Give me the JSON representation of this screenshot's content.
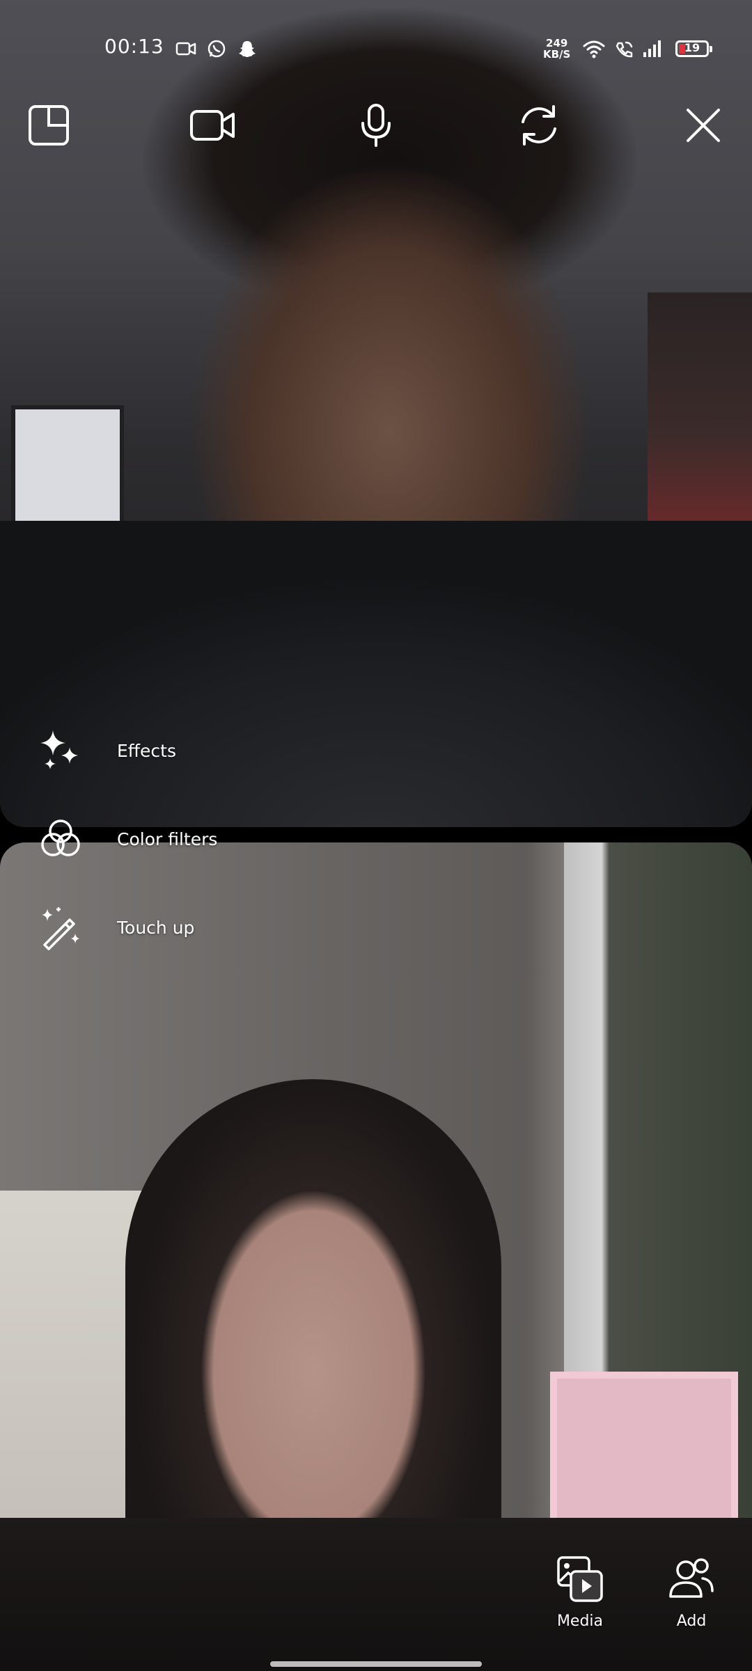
{
  "status_bar": {
    "time": "00:13",
    "network_speed_value": "249",
    "network_speed_unit": "KB/S",
    "battery_level": "19",
    "notification_icons": [
      "video-camera-icon",
      "whatsapp-icon",
      "snapchat-icon"
    ],
    "system_icons": [
      "wifi-icon",
      "wifi-calling-icon",
      "signal-icon",
      "battery-icon"
    ]
  },
  "call_controls": {
    "icons": [
      "layout-icon",
      "camera-icon",
      "microphone-icon",
      "switch-camera-icon",
      "close-icon"
    ]
  },
  "effects_menu": {
    "items": [
      {
        "label": "Effects",
        "icon": "sparkles-icon"
      },
      {
        "label": "Color filters",
        "icon": "color-filters-icon"
      },
      {
        "label": "Touch up",
        "icon": "magic-wand-icon"
      }
    ]
  },
  "bottom_actions": [
    {
      "label": "Media",
      "icon": "media-icon"
    },
    {
      "label": "Add",
      "icon": "add-person-icon"
    }
  ],
  "colors": {
    "battery_low": "#e0333b",
    "icon": "#ffffff"
  }
}
